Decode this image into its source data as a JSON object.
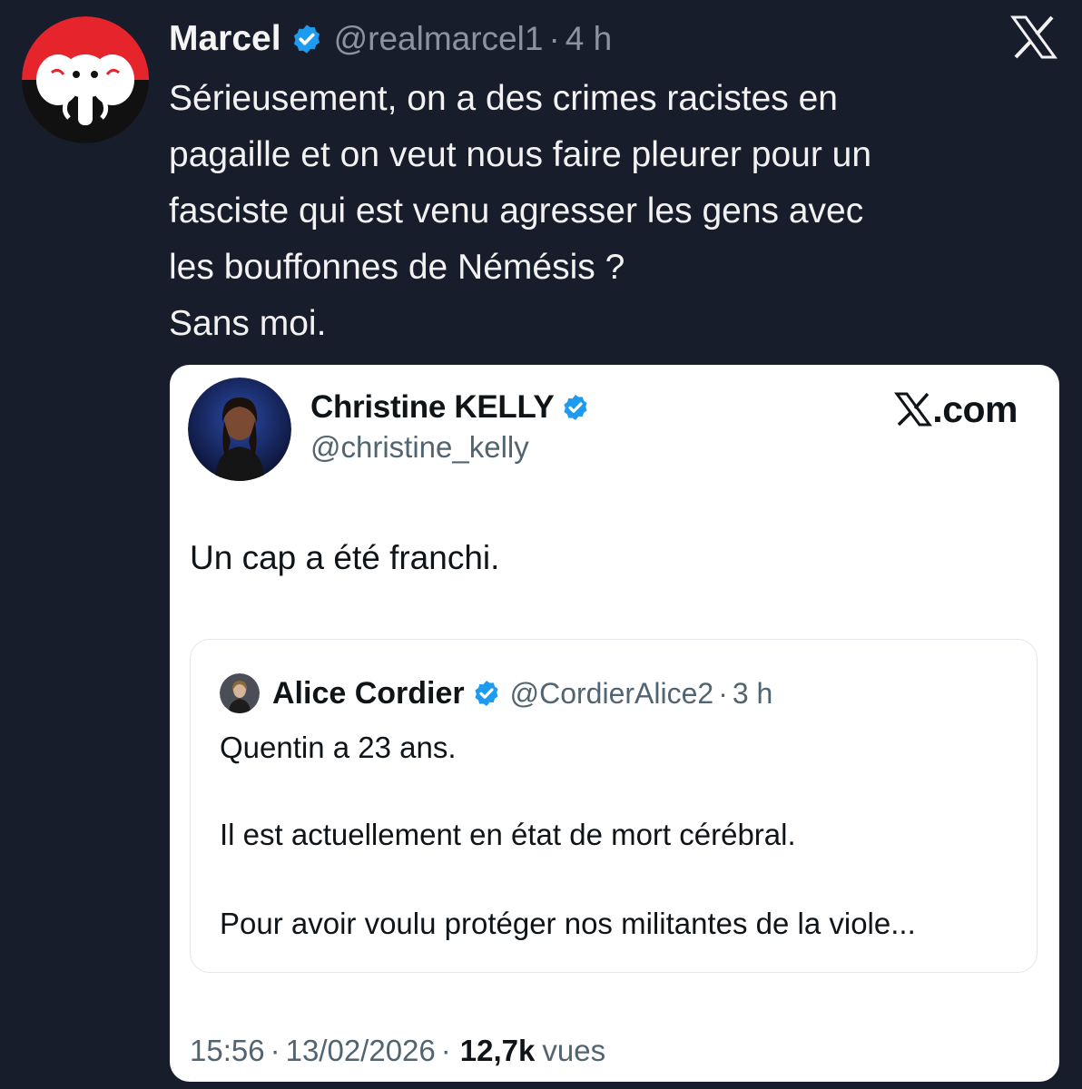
{
  "outer_tweet": {
    "author_name": "Marcel",
    "handle": "@realmarcel1",
    "separator": "·",
    "time": "4 h",
    "lines": [
      "Sérieusement, on a des crimes racistes en",
      "pagaille et on veut nous faire pleurer pour un",
      "fasciste qui est venu agresser les gens avec",
      "les bouffonnes de Némésis ?",
      "Sans moi."
    ],
    "avatar_icon": "elephant-logo-icon",
    "platform_icon": "x-logo-icon"
  },
  "embedded_tweet": {
    "author_name": "Christine KELLY",
    "handle": "@christine_kelly",
    "brand": ".com",
    "text": "Un cap a été franchi.",
    "quoted": {
      "author_name": "Alice Cordier",
      "handle": "@CordierAlice2",
      "separator": "·",
      "time": "3 h",
      "lines": [
        "Quentin a 23 ans.",
        "Il est actuellement en état de mort cérébral.",
        "Pour avoir voulu protéger nos militantes de la viole..."
      ]
    },
    "footer": {
      "time": "15:56",
      "separator": "·",
      "date": "13/02/2026",
      "separator2": "·",
      "views_count": "12,7k",
      "views_label": "vues"
    }
  },
  "colors": {
    "background": "#181d2b",
    "verified_blue": "#1d9bf0",
    "logo_red": "#e5242b"
  }
}
